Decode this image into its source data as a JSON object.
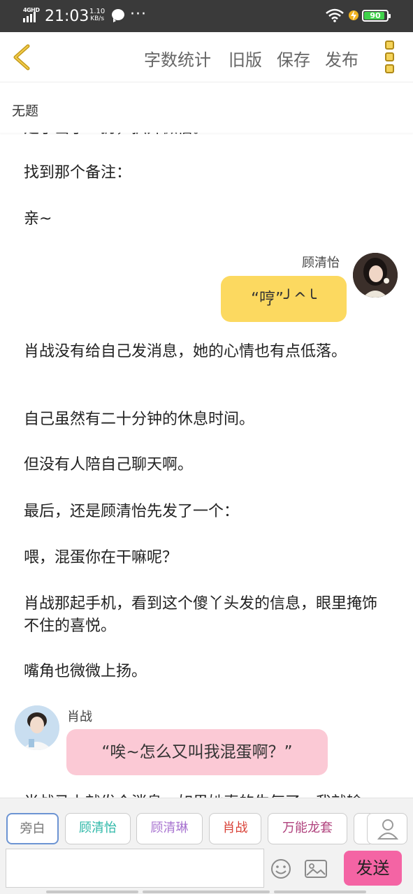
{
  "status_bar": {
    "network": "4GHD",
    "time": "21:03",
    "speed_value": "1.10",
    "speed_unit": "KB/s",
    "more": "···",
    "battery": "90",
    "battery_level_percent": 90
  },
  "toolbar": {
    "word_count": "字数统计",
    "old_version": "旧版",
    "save": "保存",
    "publish": "发布"
  },
  "document": {
    "title": "无题"
  },
  "content": {
    "partial_line": "是乎当了…扔，扒开微信。",
    "p1": "找到那个备注：",
    "p2": "亲~",
    "msg1": {
      "speaker": "顾清怡",
      "text": "“哼”╯^╰"
    },
    "p3": "肖战没有给自己发消息，她的心情也有点低落。",
    "p4": "自己虽然有二十分钟的休息时间。",
    "p5": "但没有人陪自己聊天啊。",
    "p6": "最后，还是顾清怡先发了一个：",
    "p7": "喂，混蛋你在干嘛呢？",
    "p8": "肖战那起手机，看到这个傻丫头发的信息，眼里掩饰不住的喜悦。",
    "p9": "嘴角也微微上扬。",
    "msg2": {
      "speaker": "肖战",
      "text": "“唉~怎么又叫我混蛋啊？”"
    },
    "partial_bottom": "肖战马上就发个消息，如果她真的生气了，我就输"
  },
  "roles": [
    {
      "label": "旁白",
      "color": "#777777"
    },
    {
      "label": "顾清怡",
      "color": "#2bb7a7"
    },
    {
      "label": "顾清琳",
      "color": "#a874d0"
    },
    {
      "label": "肖战",
      "color": "#d9443a"
    },
    {
      "label": "万能龙套",
      "color": "#b0427d"
    }
  ],
  "input": {
    "placeholder": "",
    "send": "发送"
  },
  "colors": {
    "accent_yellow": "#fcd960",
    "bubble_pink": "#fbc9d5",
    "send_pink": "#f464a4",
    "back_gold": "#c49a1b"
  },
  "icons": [
    "back-arrow-icon",
    "menu-icon",
    "profile-icon",
    "emoji-icon",
    "image-icon",
    "wifi-icon",
    "charging-icon",
    "chat-icon"
  ]
}
